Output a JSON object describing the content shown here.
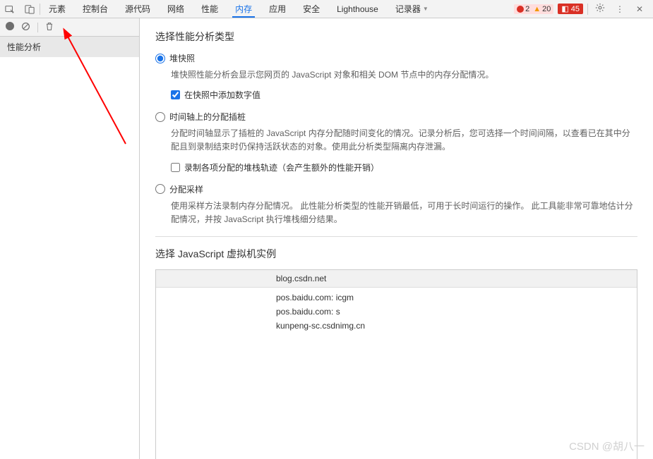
{
  "topbar": {
    "tabs": [
      "元素",
      "控制台",
      "源代码",
      "网络",
      "性能",
      "内存",
      "应用",
      "安全",
      "Lighthouse",
      "记录器"
    ],
    "active_tab_index": 5,
    "errors": "2",
    "warnings": "20",
    "issues": "45"
  },
  "sidebar": {
    "item_label": "性能分析"
  },
  "content": {
    "select_type_title": "选择性能分析类型",
    "options": [
      {
        "label": "堆快照",
        "desc": "堆快照性能分析会显示您网页的 JavaScript 对象和相关 DOM 节点中的内存分配情况。",
        "sub_checkbox_label": "在快照中添加数字值",
        "sub_checked": true
      },
      {
        "label": "时间轴上的分配插桩",
        "desc": "分配时间轴显示了插桩的 JavaScript 内存分配随时间变化的情况。记录分析后，您可选择一个时间间隔，以查看已在其中分配且到录制结束时仍保持活跃状态的对象。使用此分析类型隔离内存泄漏。",
        "sub_checkbox_label": "录制各项分配的堆栈轨迹（会产生额外的性能开销）",
        "sub_checked": false
      },
      {
        "label": "分配采样",
        "desc": "使用采样方法录制内存分配情况。 此性能分析类型的性能开销最低，可用于长时间运行的操作。 此工具能非常可靠地估计分配情况，并按 JavaScript 执行堆栈细分结果。"
      }
    ],
    "selected_option_index": 0,
    "vm_title": "选择 JavaScript 虚拟机实例",
    "vm_instances": {
      "header": "blog.csdn.net",
      "rows": [
        "pos.baidu.com: icgm",
        "pos.baidu.com: s",
        "kunpeng-sc.csdnimg.cn"
      ]
    }
  },
  "watermark": "CSDN @胡八一"
}
